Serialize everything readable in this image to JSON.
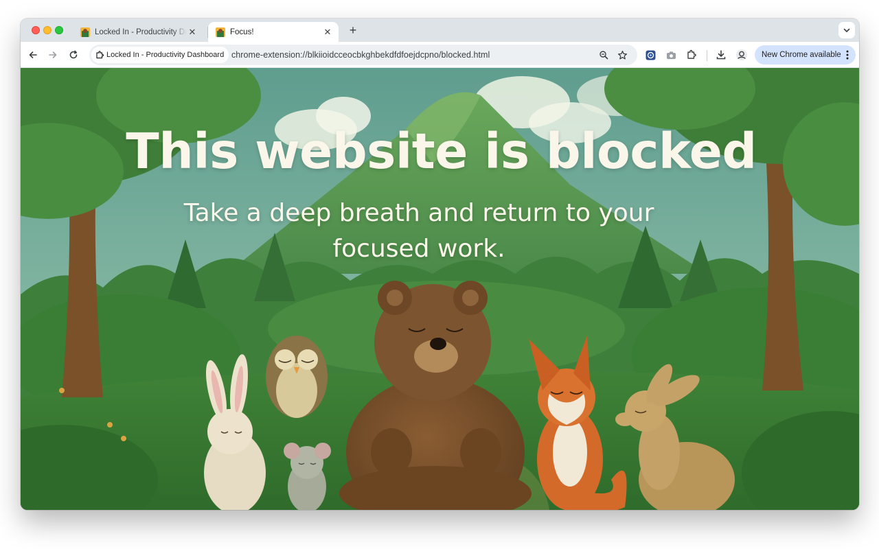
{
  "browser": {
    "tabs": [
      {
        "title": "Locked In - Productivity Dashboard",
        "active": false
      },
      {
        "title": "Focus!",
        "active": true
      }
    ],
    "new_tab_label": "+",
    "close_glyph": "✕",
    "chip_label": "Locked In - Productivity Dashboard",
    "url": "chrome-extension://blkiioidcceocbkghbekdfdfoejdcpno/blocked.html",
    "update_label": "New Chrome available"
  },
  "page": {
    "headline": "This website is blocked",
    "message": "Take a deep breath and return to your focused work."
  },
  "colors": {
    "accent": "#d3e3fd",
    "text_on_image": "#fbf6ea",
    "forest": "#3e7a3a"
  },
  "icons": [
    "back-icon",
    "forward-icon",
    "reload-icon",
    "extension-page-icon",
    "zoom-icon",
    "bookmark-star-icon",
    "extension-blue-icon",
    "camera-icon",
    "puzzle-icon",
    "download-icon",
    "profile-icon",
    "more-vert-icon",
    "tab-search-chevron-icon"
  ]
}
